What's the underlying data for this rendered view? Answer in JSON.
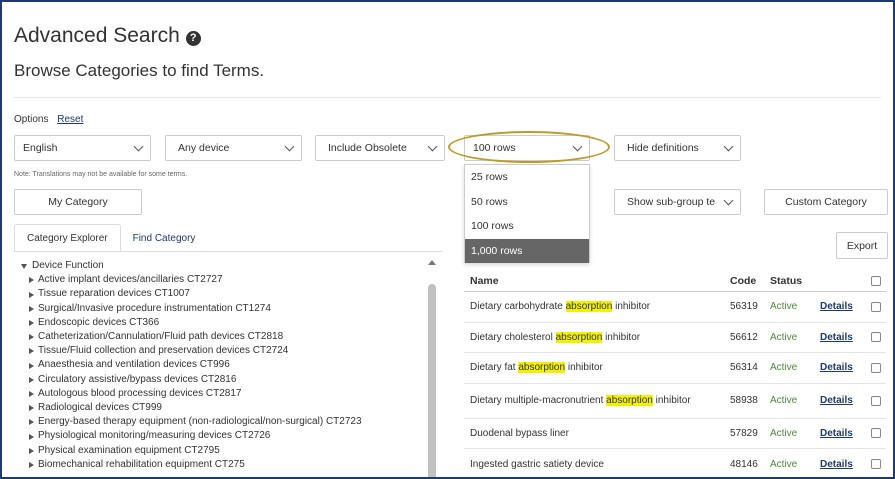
{
  "header": {
    "title": "Advanced Search",
    "help_icon": "?",
    "subtitle": "Browse Categories to find Terms."
  },
  "options": {
    "label": "Options",
    "reset": "Reset"
  },
  "filters": {
    "language": "English",
    "device": "Any device",
    "obsolete": "Include Obsolete",
    "rows": "100 rows",
    "definitions": "Hide definitions",
    "subgroup": "Show sub-group te"
  },
  "note": "Note: Translations may not be available for some terms.",
  "buttons": {
    "my_category": "My Category",
    "custom_category": "Custom Category",
    "export": "Export"
  },
  "tabs": {
    "explorer": "Category Explorer",
    "find": "Find Category"
  },
  "tree": {
    "root": "Device Function",
    "items": [
      "Active implant devices/ancillaries CT2727",
      "Tissue reparation devices CT1007",
      "Surgical/Invasive procedure instrumentation CT1274",
      "Endoscopic devices CT366",
      "Catheterization/Cannulation/Fluid path devices CT2818",
      "Tissue/Fluid collection and preservation devices CT2724",
      "Anaesthesia and ventilation devices CT996",
      "Circulatory assistive/bypass devices CT2816",
      "Autologous blood processing devices CT2817",
      "Radiological devices CT999",
      "Energy-based therapy equipment (non-radiological/non-surgical) CT2723",
      "Physiological monitoring/measuring devices CT2726",
      "Physical examination equipment CT2795",
      "Biomechanical rehabilitation equipment CT275"
    ]
  },
  "rows_dropdown": {
    "options": [
      "25 rows",
      "50 rows",
      "100 rows",
      "1,000 rows"
    ],
    "selected": "1,000 rows"
  },
  "table": {
    "headers": {
      "name": "Name",
      "code": "Code",
      "status": "Status"
    },
    "details_label": "Details",
    "rows": [
      {
        "before": "Dietary carbohydrate ",
        "match": "absorption",
        "after": " inhibitor",
        "code": "56319",
        "status": "Active"
      },
      {
        "before": "Dietary cholesterol ",
        "match": "absorption",
        "after": " inhibitor",
        "code": "56612",
        "status": "Active"
      },
      {
        "before": "Dietary fat ",
        "match": "absorption",
        "after": " inhibitor",
        "code": "56314",
        "status": "Active"
      },
      {
        "before": "Dietary multiple-macronutrient ",
        "match": "absorption",
        "after": " inhibitor",
        "code": "58938",
        "status": "Active"
      },
      {
        "before": "Duodenal bypass liner",
        "match": "",
        "after": "",
        "code": "57829",
        "status": "Active"
      },
      {
        "before": "Ingested gastric satiety device",
        "match": "",
        "after": "",
        "code": "48146",
        "status": "Active"
      }
    ]
  },
  "colors": {
    "brand": "#1f3a6e",
    "highlight": "#f2f200",
    "active": "#4a8a3a",
    "annotation": "#c09a2c"
  }
}
